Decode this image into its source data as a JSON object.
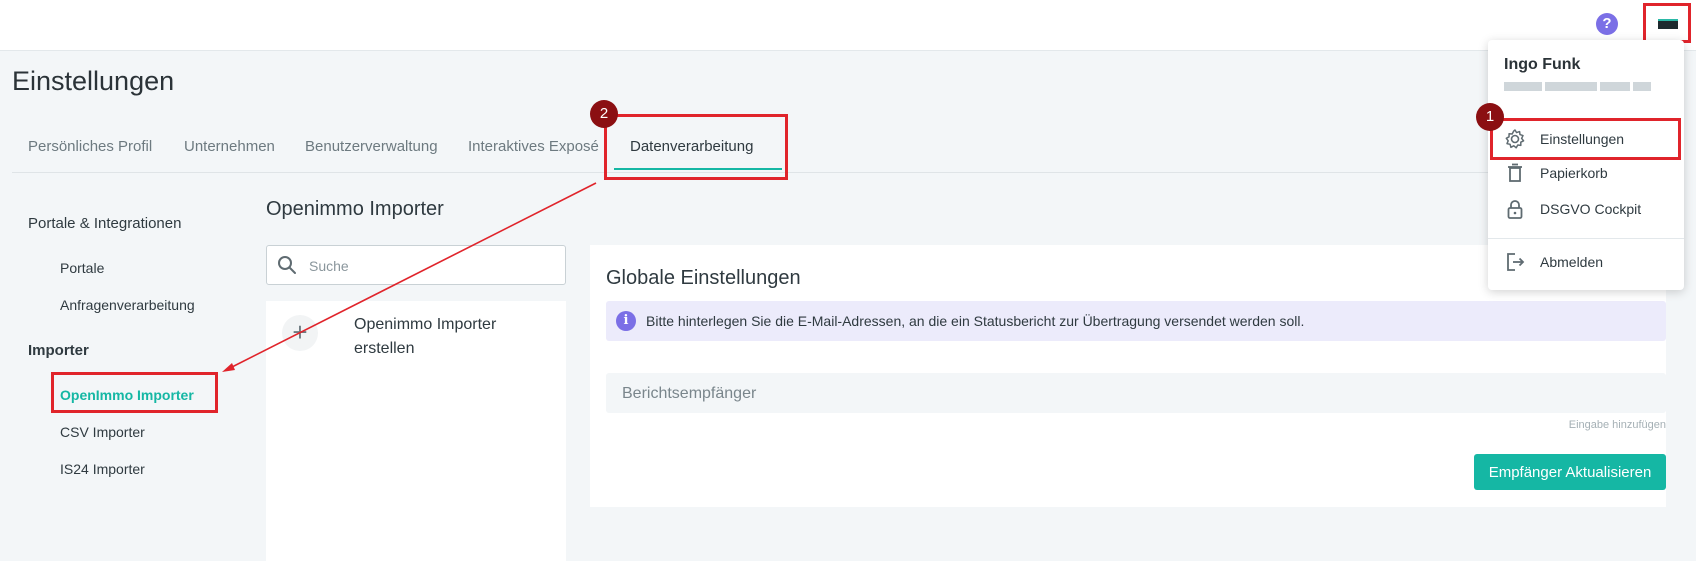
{
  "header": {
    "help_icon": "question-circle-icon",
    "help_glyph": "?",
    "avatar_icon": "avatar-icon"
  },
  "page": {
    "title": "Einstellungen"
  },
  "tabs": [
    {
      "label": "Persönliches Profil"
    },
    {
      "label": "Unternehmen"
    },
    {
      "label": "Benutzerverwaltung"
    },
    {
      "label": "Interaktives Exposé"
    },
    {
      "label": "Datenverarbeitung",
      "active": true
    }
  ],
  "sidebar": {
    "groups": [
      {
        "label": "Portale & Integrationen",
        "items": [
          {
            "label": "Portale"
          },
          {
            "label": "Anfragenverarbeitung"
          }
        ]
      },
      {
        "label": "Importer",
        "items": [
          {
            "label": "OpenImmo Importer",
            "active": true
          },
          {
            "label": "CSV Importer"
          },
          {
            "label": "IS24 Importer"
          }
        ]
      }
    ]
  },
  "importer_list": {
    "title": "Openimmo Importer",
    "search_placeholder": "Suche",
    "items": [
      {
        "label": "Openimmo Importer erstellen",
        "icon": "plus-icon",
        "glyph": "+"
      }
    ]
  },
  "global_settings": {
    "title": "Globale Einstellungen",
    "info_text": "Bitte hinterlegen Sie die E-Mail-Adressen, an die ein Statusbericht zur Übertragung versendet werden soll.",
    "info_glyph": "i",
    "recipient_placeholder": "Berichtsempfänger",
    "hint": "Eingabe hinzufügen",
    "submit_label": "Empfänger Aktualisieren"
  },
  "user_menu": {
    "name": "Ingo Funk",
    "items": [
      {
        "label": "Einstellungen",
        "icon": "gear-icon"
      },
      {
        "label": "Papierkorb",
        "icon": "trash-icon"
      },
      {
        "label": "DSGVO Cockpit",
        "icon": "lock-icon"
      },
      {
        "label": "Abmelden",
        "icon": "logout-icon"
      }
    ]
  },
  "annotations": {
    "step1": "1",
    "step2": "2"
  },
  "colors": {
    "accent": "#15b7a4",
    "annotation_red": "#e0242b",
    "badge": "#8b0f12",
    "info_bg": "#ecebfb",
    "info_icon": "#7b6fe6"
  }
}
